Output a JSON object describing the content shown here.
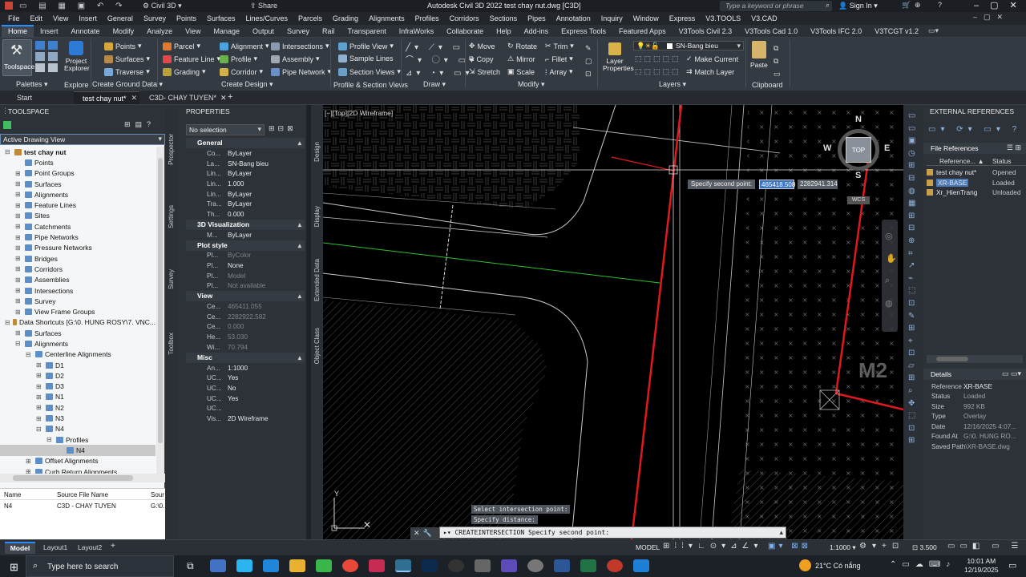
{
  "title": {
    "app_search_label": "Civil 3D",
    "share": "Share",
    "window_title": "Autodesk Civil 3D 2022    test chay nut.dwg [C3D]",
    "search_placeholder": "Type a keyword or phrase",
    "sign_in": "Sign In"
  },
  "menu": [
    "File",
    "Edit",
    "View",
    "Insert",
    "General",
    "Survey",
    "Points",
    "Surfaces",
    "Lines/Curves",
    "Parcels",
    "Grading",
    "Alignments",
    "Profiles",
    "Corridors",
    "Sections",
    "Pipes",
    "Annotation",
    "Inquiry",
    "Window",
    "Express",
    "V3.TOOLS",
    "V3.CAD"
  ],
  "ribbon_tabs": [
    "Home",
    "Insert",
    "Annotate",
    "Modify",
    "Analyze",
    "View",
    "Manage",
    "Output",
    "Survey",
    "Rail",
    "Transparent",
    "InfraWorks",
    "Collaborate",
    "Help",
    "Add-ins",
    "Express Tools",
    "Featured Apps",
    "V3Tools Civil 2.3",
    "V3Tools Cad 1.0",
    "V3Tools IFC 2.0",
    "V3TCGT v1.2"
  ],
  "ribbon": {
    "toolspace": "Toolspace",
    "project_explorer": "Project Explorer",
    "palettes": "Palettes",
    "explore": "Explore",
    "ground": {
      "points": "Points",
      "surfaces": "Surfaces",
      "traverse": "Traverse",
      "title": "Create Ground Data"
    },
    "design": {
      "parcel": "Parcel",
      "feature_line": "Feature Line",
      "grading": "Grading",
      "alignment": "Alignment",
      "profile": "Profile",
      "corridor": "Corridor",
      "intersections": "Intersections",
      "assembly": "Assembly",
      "pipe_network": "Pipe Network",
      "title": "Create Design"
    },
    "profsec": {
      "profile_view": "Profile View",
      "sample_lines": "Sample Lines",
      "section_views": "Section Views",
      "title": "Profile & Section Views"
    },
    "draw_title": "Draw",
    "modify": {
      "move": "Move",
      "copy": "Copy",
      "stretch": "Stretch",
      "rotate": "Rotate",
      "mirror": "Mirror",
      "scale": "Scale",
      "trim": "Trim",
      "fillet": "Fillet",
      "array": "Array",
      "title": "Modify"
    },
    "layers": {
      "layer_props": "Layer Properties",
      "layer_name": "SN-Bang bieu",
      "make_current": "Make Current",
      "match_layer": "Match Layer",
      "title": "Layers"
    },
    "clipboard": {
      "paste": "Paste",
      "title": "Clipboard"
    }
  },
  "doc_tabs": {
    "start": "Start",
    "tab1": "test chay nut*",
    "tab2": "C3D- CHAY TUYEN*"
  },
  "toolspace": {
    "header": "TOOLSPACE",
    "view_select": "Active Drawing View",
    "tree": [
      {
        "indent": 0,
        "label": "test chay nut",
        "bold": true,
        "exp": "⊟"
      },
      {
        "indent": 1,
        "label": "Points",
        "exp": ""
      },
      {
        "indent": 1,
        "label": "Point Groups",
        "exp": "⊞"
      },
      {
        "indent": 1,
        "label": "Surfaces",
        "exp": "⊞"
      },
      {
        "indent": 1,
        "label": "Alignments",
        "exp": "⊞"
      },
      {
        "indent": 1,
        "label": "Feature Lines",
        "exp": "⊞"
      },
      {
        "indent": 1,
        "label": "Sites",
        "exp": "⊞"
      },
      {
        "indent": 1,
        "label": "Catchments",
        "exp": "⊞"
      },
      {
        "indent": 1,
        "label": "Pipe Networks",
        "exp": "⊞"
      },
      {
        "indent": 1,
        "label": "Pressure Networks",
        "exp": "⊞"
      },
      {
        "indent": 1,
        "label": "Bridges",
        "exp": "⊞"
      },
      {
        "indent": 1,
        "label": "Corridors",
        "exp": "⊞"
      },
      {
        "indent": 1,
        "label": "Assemblies",
        "exp": "⊞"
      },
      {
        "indent": 1,
        "label": "Intersections",
        "exp": "⊞"
      },
      {
        "indent": 1,
        "label": "Survey",
        "exp": "⊞"
      },
      {
        "indent": 1,
        "label": "View Frame Groups",
        "exp": "⊞"
      },
      {
        "indent": 0,
        "label": "Data Shortcuts [G:\\0. HUNG ROSY\\7. VNC...",
        "exp": "⊟"
      },
      {
        "indent": 1,
        "label": "Surfaces",
        "exp": "⊞"
      },
      {
        "indent": 1,
        "label": "Alignments",
        "exp": "⊟"
      },
      {
        "indent": 2,
        "label": "Centerline Alignments",
        "exp": "⊟"
      },
      {
        "indent": 3,
        "label": "D1",
        "exp": "⊞"
      },
      {
        "indent": 3,
        "label": "D2",
        "exp": "⊞"
      },
      {
        "indent": 3,
        "label": "D3",
        "exp": "⊞"
      },
      {
        "indent": 3,
        "label": "N1",
        "exp": "⊞"
      },
      {
        "indent": 3,
        "label": "N2",
        "exp": "⊞"
      },
      {
        "indent": 3,
        "label": "N3",
        "exp": "⊞"
      },
      {
        "indent": 3,
        "label": "N4",
        "exp": "⊟"
      },
      {
        "indent": 4,
        "label": "Profiles",
        "exp": "⊟"
      },
      {
        "indent": 5,
        "label": "N4",
        "exp": "",
        "selected": true
      },
      {
        "indent": 2,
        "label": "Offset Alignments",
        "exp": "⊞"
      },
      {
        "indent": 2,
        "label": "Curb Return Alignments",
        "exp": "⊞"
      }
    ],
    "list_headers": [
      "Name",
      "Source File Name",
      "Sour"
    ],
    "list_row": [
      "N4",
      "C3D - CHAY TUYEN",
      "G:\\0."
    ]
  },
  "side_tabs_left": [
    "Prospector",
    "Settings",
    "Survey",
    "Toolbox"
  ],
  "side_tabs_props": [
    "Design",
    "Display",
    "Extended Data",
    "Object Class"
  ],
  "properties": {
    "header": "PROPERTIES",
    "selection": "No selection",
    "sections": [
      {
        "title": "General",
        "rows": [
          [
            "Co...",
            "ByLayer"
          ],
          [
            "La...",
            "SN-Bang bieu"
          ],
          [
            "Lin...",
            "ByLayer"
          ],
          [
            "Lin...",
            "1.000"
          ],
          [
            "Lin...",
            "ByLayer"
          ],
          [
            "Tra...",
            "ByLayer"
          ],
          [
            "Th...",
            "0.000"
          ]
        ]
      },
      {
        "title": "3D Visualization",
        "rows": [
          [
            "M...",
            "ByLayer"
          ]
        ]
      },
      {
        "title": "Plot style",
        "rows": [
          [
            "Pl...",
            "ByColor",
            "dim"
          ],
          [
            "Pl...",
            "None"
          ],
          [
            "Pl...",
            "Model",
            "dim"
          ],
          [
            "Pl...",
            "Not available",
            "dim"
          ]
        ]
      },
      {
        "title": "View",
        "rows": [
          [
            "Ce...",
            "465411.055",
            "dim"
          ],
          [
            "Ce...",
            "2282922.582",
            "dim"
          ],
          [
            "Ce...",
            "0.000",
            "dim"
          ],
          [
            "He...",
            "53.030",
            "dim"
          ],
          [
            "Wi...",
            "70.794",
            "dim"
          ]
        ]
      },
      {
        "title": "Misc",
        "rows": [
          [
            "An...",
            "1:1000"
          ],
          [
            "UC...",
            "Yes"
          ],
          [
            "UC...",
            "No"
          ],
          [
            "UC...",
            "Yes"
          ],
          [
            "UC...",
            ""
          ],
          [
            "Vis...",
            "2D Wireframe"
          ]
        ]
      }
    ]
  },
  "viewport": {
    "label": "[−][Top][2D Wireframe]",
    "prompt": "Specify second point:",
    "x_value": "465418.508",
    "y_value": "2282941.314",
    "viewcube": {
      "n": "N",
      "s": "S",
      "e": "E",
      "w": "W",
      "top": "TOP",
      "wcs": "WCS"
    },
    "zone_label": "M2",
    "ucs_y": "Y",
    "cmd_history1": "Select intersection point:",
    "cmd_history2": "Specify distance:",
    "cmd_line": "CREATEINTERSECTION Specify second point:"
  },
  "xref": {
    "header": "EXTERNAL REFERENCES",
    "file_refs": "File References",
    "col_ref": "Reference...",
    "col_status": "Status",
    "rows": [
      [
        "test chay nut*",
        "Opened"
      ],
      [
        "XR-BASE",
        "Loaded"
      ],
      [
        "Xr_HienTrang",
        "Unloaded"
      ]
    ],
    "details_title": "Details",
    "details": [
      [
        "Reference ...",
        "XR-BASE"
      ],
      [
        "Status",
        "Loaded"
      ],
      [
        "Size",
        "992 KB"
      ],
      [
        "Type",
        "Overlay"
      ],
      [
        "Date",
        "12/16/2025 4:07..."
      ],
      [
        "Found At",
        "G:\\0. HUNG RO..."
      ],
      [
        "Saved Path",
        ".\\XR-BASE.dwg"
      ]
    ]
  },
  "layout_tabs": [
    "Model",
    "Layout1",
    "Layout2"
  ],
  "status": {
    "model": "MODEL",
    "scale": "1:1000",
    "zoom": "3.500"
  },
  "taskbar": {
    "search": "Type here to search",
    "weather": "21°C  Có nắng",
    "time": "10:01 AM",
    "date": "12/19/2025"
  },
  "colors": {
    "accent": "#2d8cff",
    "red_line": "#e0191e",
    "green_line": "#2fbf2f",
    "selected": "#4a79b8"
  }
}
